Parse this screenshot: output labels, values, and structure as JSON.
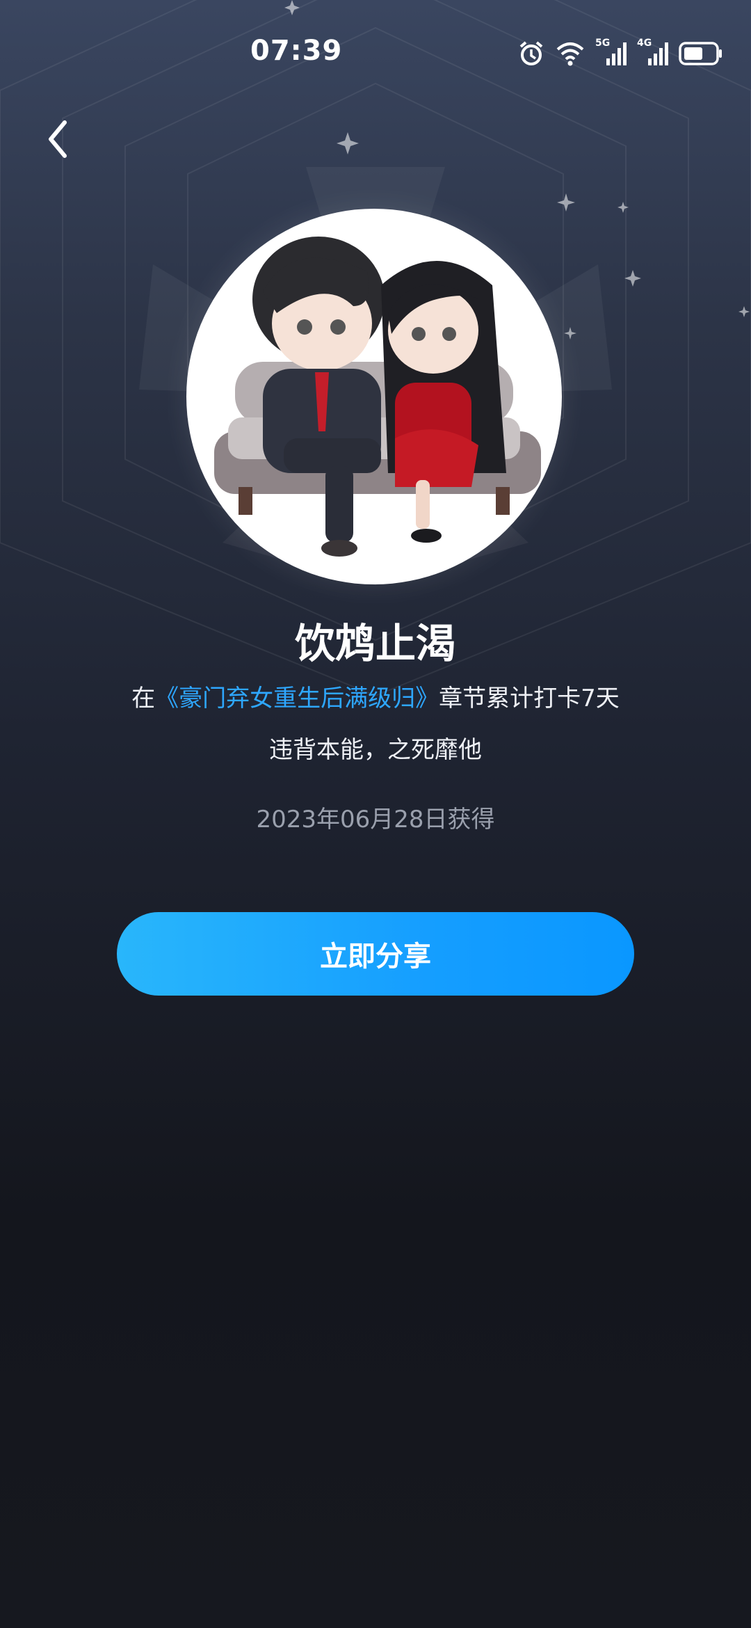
{
  "status_bar": {
    "time": "07:39",
    "network_1": "5G",
    "network_2": "4G",
    "icons": [
      "alarm-icon",
      "wifi-icon",
      "signal-icon",
      "signal-icon",
      "battery-icon"
    ]
  },
  "nav": {
    "back_icon": "chevron-left-icon"
  },
  "badge": {
    "title": "饮鸩止渴",
    "desc_prefix": "在",
    "book_link": "《豪门弃女重生后满级归》",
    "desc_suffix": "章节累计打卡7天",
    "subtitle": "违背本能，之死靡他",
    "obtained_date": "2023年06月28日获得"
  },
  "actions": {
    "share_label": "立即分享"
  },
  "colors": {
    "accent": "#159eff",
    "link": "#2ea7ff",
    "date_text": "#9aa0ad"
  }
}
